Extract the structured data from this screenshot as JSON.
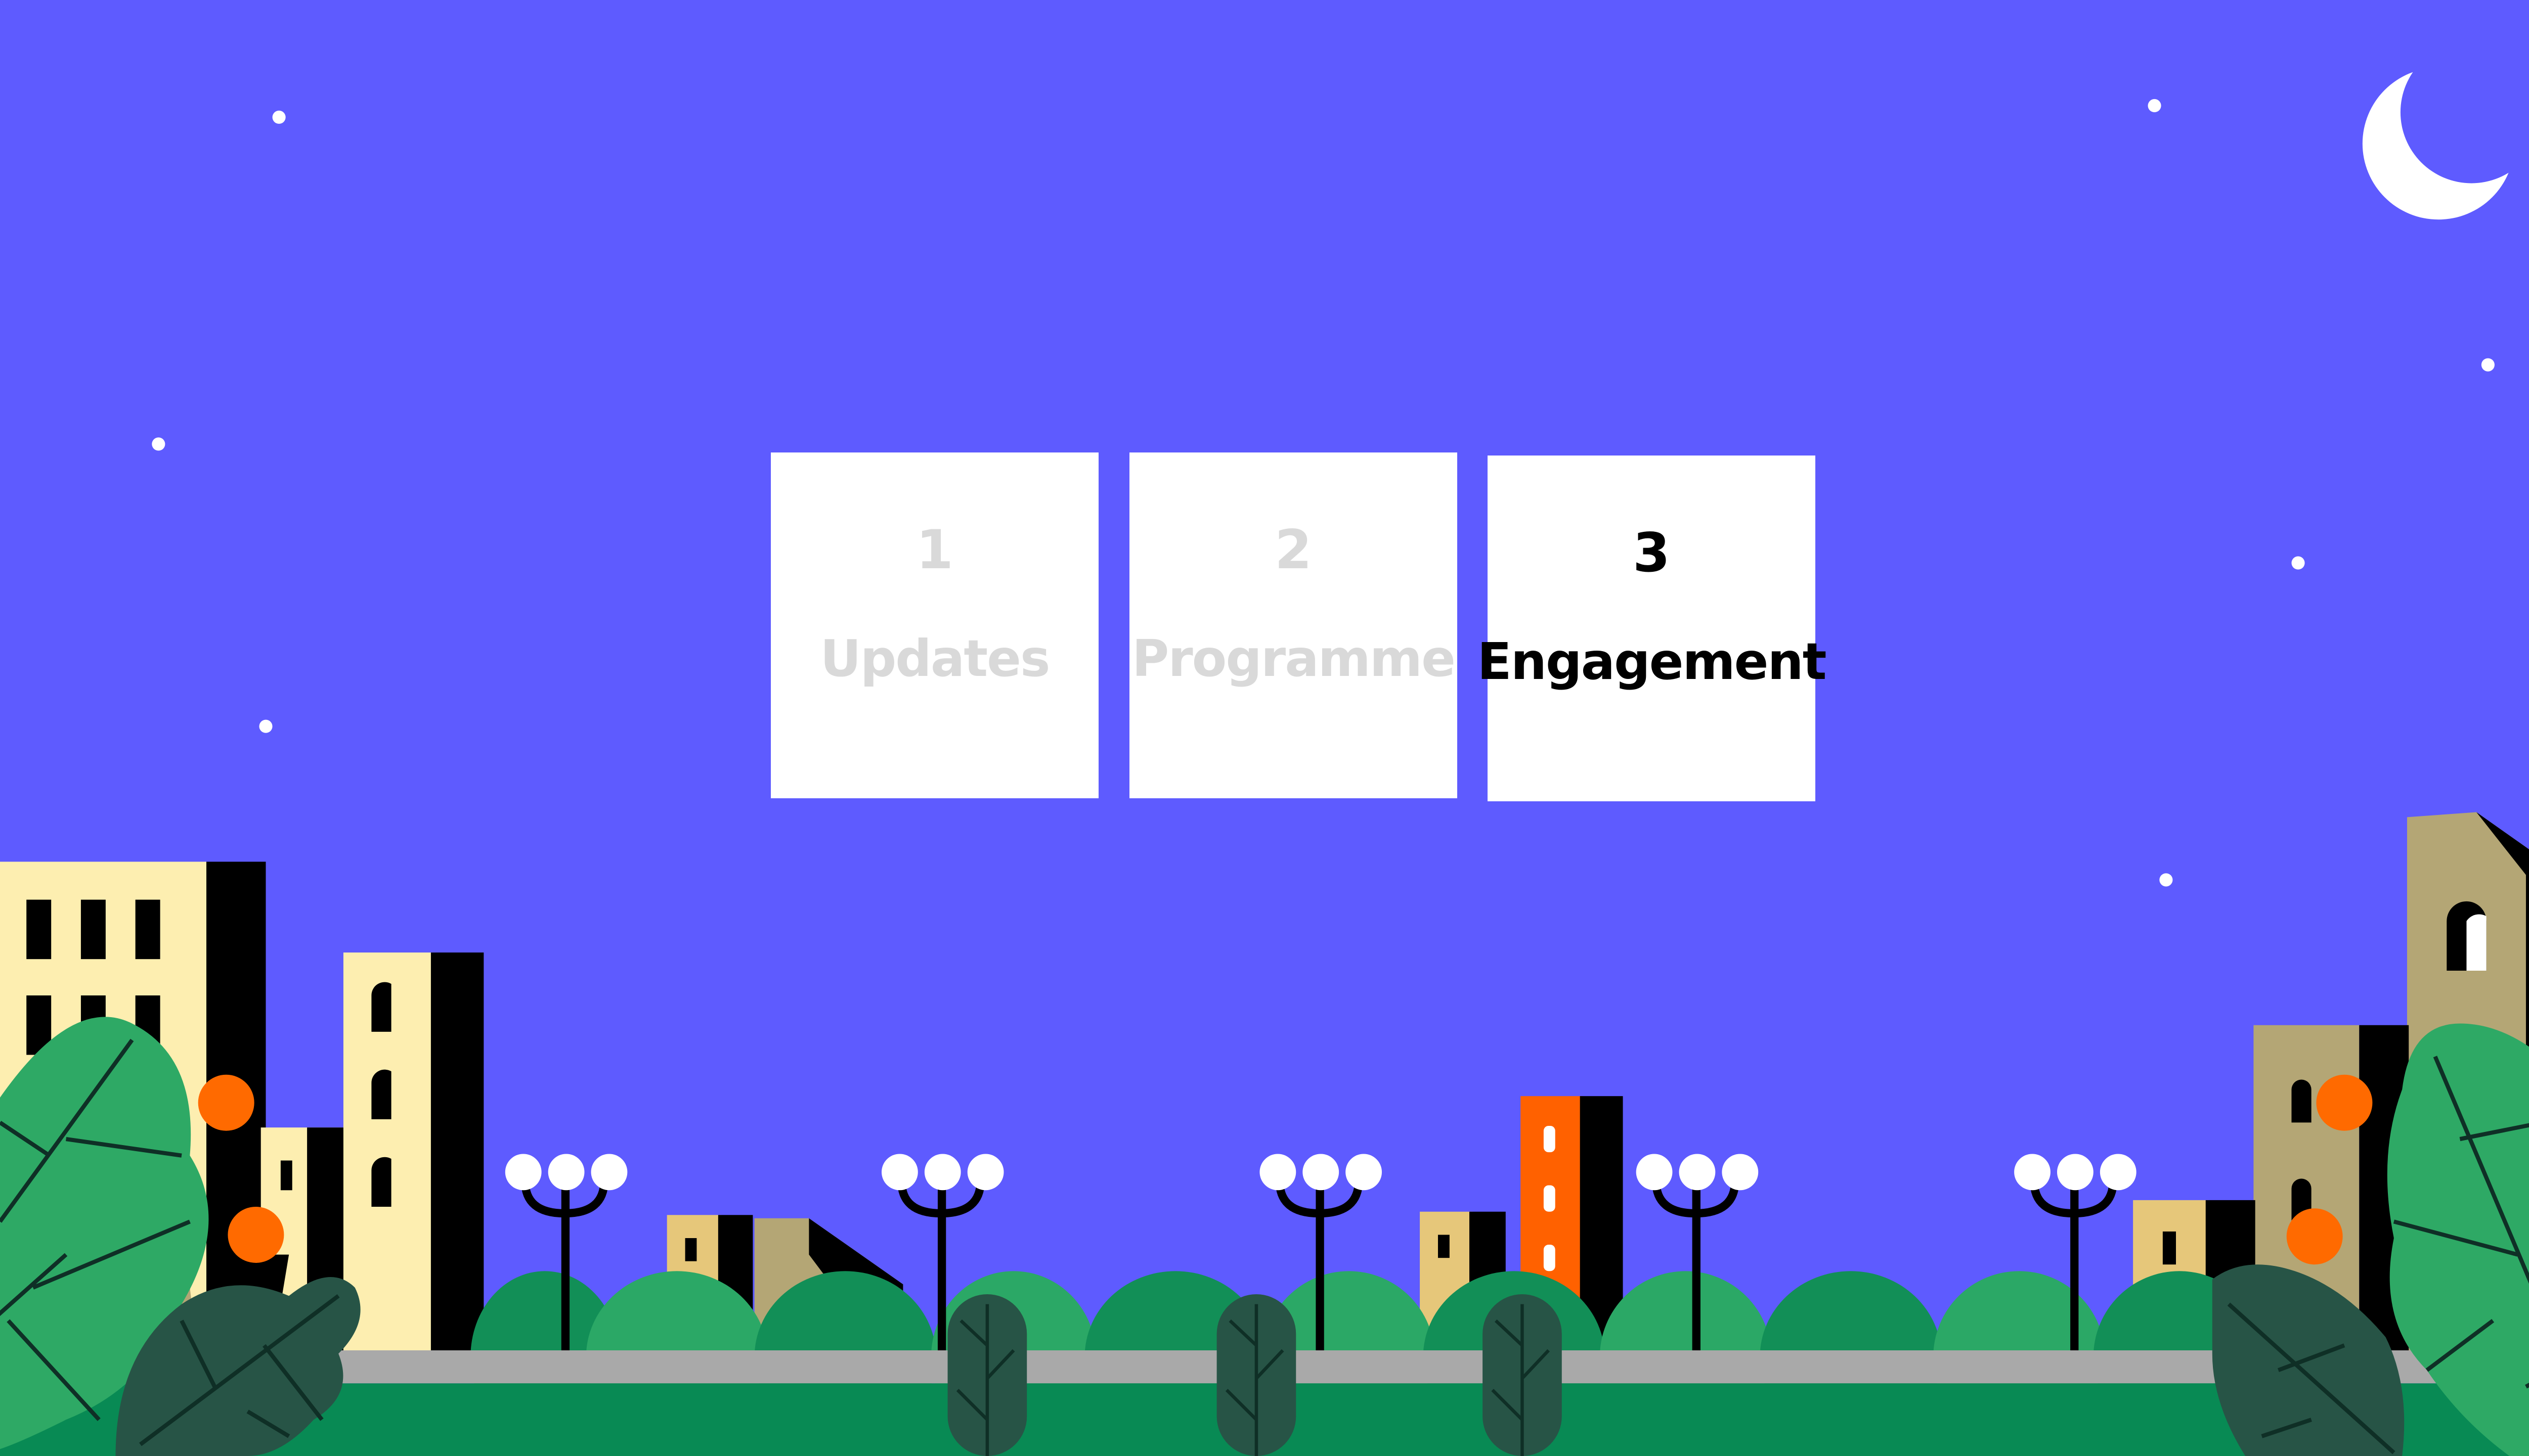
{
  "colors": {
    "sky": "#5e5bff",
    "star": "#ffffff",
    "moon": "#ffffff",
    "active_text": "#000000",
    "inactive_text": "#d9d9d9",
    "building_cream": "#fdeeb0",
    "building_tan": "#b4a675",
    "building_mustard": "#e6c77a",
    "building_orange": "#ff6100",
    "leaf_light": "#2ea965",
    "leaf_dark": "#275446",
    "bush": "#2ba866",
    "bush_dark": "#128f57",
    "grass": "#088a54",
    "road": "#a9a9a9",
    "lamp_post": "#000000",
    "fruit": "#ff6a00"
  },
  "tabs": [
    {
      "number": "1",
      "label": "Updates",
      "state": "inactive"
    },
    {
      "number": "2",
      "label": "Programme",
      "state": "inactive"
    },
    {
      "number": "3",
      "label": "Engagement",
      "state": "active"
    }
  ],
  "icons": {
    "moon": "crescent-moon-icon",
    "star": "star-dot-icon",
    "lamp": "street-lamp-icon"
  }
}
